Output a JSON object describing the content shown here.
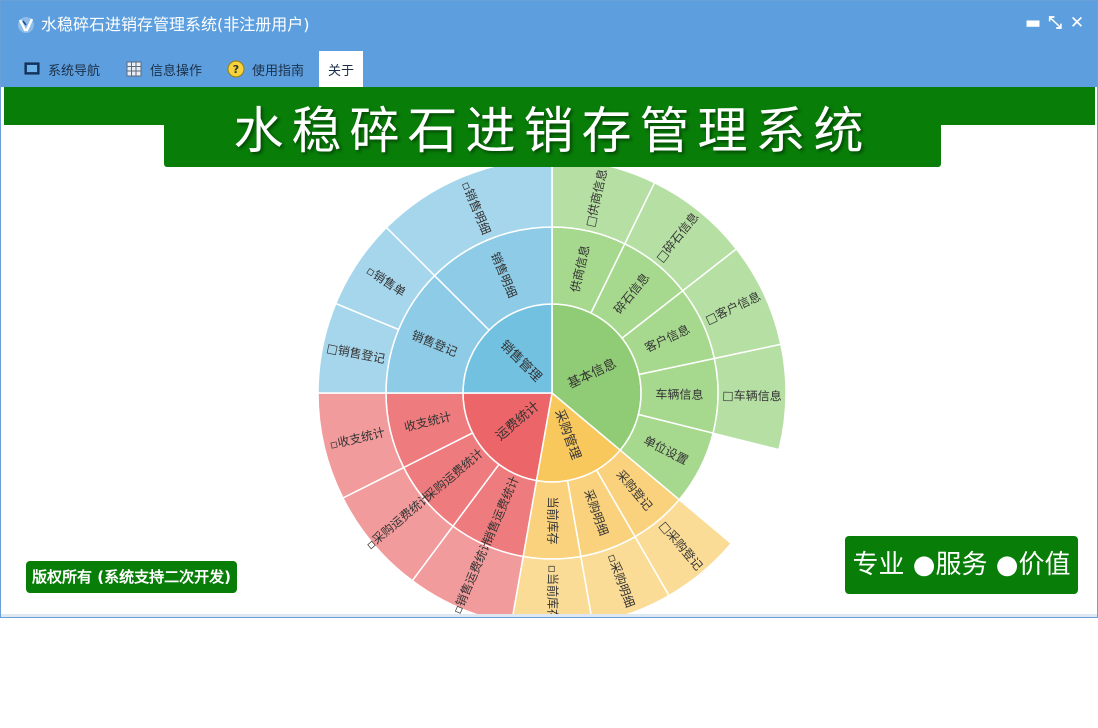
{
  "window": {
    "title": "水稳碎石进销存管理系统(非注册用户)",
    "controls": {
      "minimize": "▬",
      "restore": "⤡",
      "close": "✕"
    }
  },
  "menu": [
    {
      "label": "系统导航",
      "icon": "monitor-icon"
    },
    {
      "label": "信息操作",
      "icon": "grid-icon"
    },
    {
      "label": "使用指南",
      "icon": "help-icon"
    },
    {
      "label": "关于",
      "icon": ""
    }
  ],
  "banner_title": "水稳碎石进销存管理系统",
  "copyright": "版权所有 (系统支持二次开发)",
  "slogan": "专业 ●服务 ●价值",
  "colors": {
    "titlebar": "#5d9fde",
    "brand_green": "#087d08"
  },
  "sunburst": {
    "groups": [
      {
        "label": "基本信息",
        "color": "#90cc75",
        "color2": "#a6d88e",
        "color3": "#b6e0a3",
        "children": [
          {
            "label": "供商信息",
            "leaves": [
              "□供商信息"
            ]
          },
          {
            "label": "碎石信息",
            "leaves": [
              "□碎石信息"
            ]
          },
          {
            "label": "客户信息",
            "leaves": [
              "□客户信息"
            ]
          },
          {
            "label": "车辆信息",
            "leaves": [
              "□车辆信息"
            ]
          },
          {
            "label": "单位设置",
            "leaves": []
          }
        ]
      },
      {
        "label": "采购管理",
        "color": "#f9c85d",
        "color2": "#fad27d",
        "color3": "#fbdc97",
        "children": [
          {
            "label": "采购登记",
            "leaves": [
              "□采购登记"
            ]
          },
          {
            "label": "采购明细",
            "leaves": [
              "▫采购明细"
            ]
          },
          {
            "label": "当前库存",
            "leaves": [
              "▫当前库存"
            ]
          }
        ]
      },
      {
        "label": "运费统计",
        "color": "#ec6568",
        "color2": "#ee7b7d",
        "color3": "#f29b9c",
        "children": [
          {
            "label": "销售运费统计",
            "leaves": [
              "▫销售运费统计"
            ]
          },
          {
            "label": "采购运费统计",
            "leaves": [
              "▫采购运费统计"
            ]
          },
          {
            "label": "收支统计",
            "leaves": [
              "▫收支统计"
            ]
          }
        ]
      },
      {
        "label": "销售管理",
        "color": "#72c1e0",
        "color2": "#8dcbe6",
        "color3": "#a6d6ec",
        "children": [
          {
            "label": "销售登记",
            "leaves": [
              "□销售登记",
              "▫销售单"
            ]
          },
          {
            "label": "销售明细",
            "leaves": [
              "▫销售明细"
            ]
          }
        ]
      }
    ]
  }
}
